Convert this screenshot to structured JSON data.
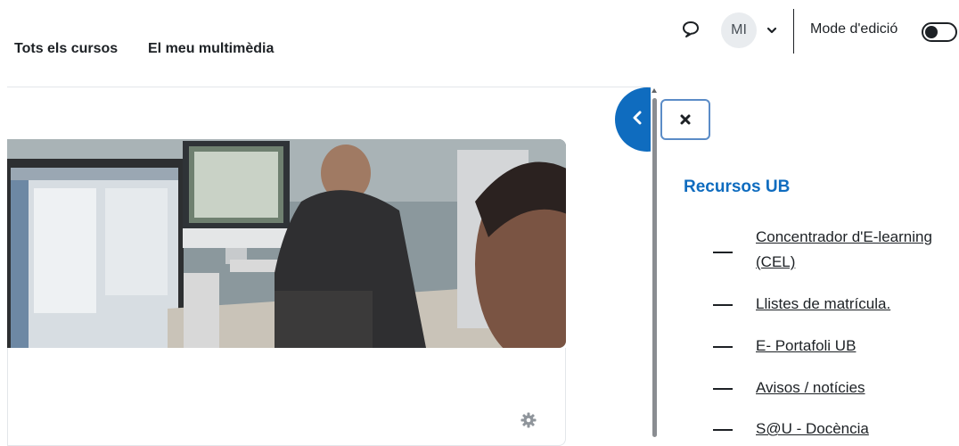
{
  "nav": {
    "links": [
      {
        "label": "Tots els cursos"
      },
      {
        "label": "El meu multimèdia"
      }
    ],
    "user_initials": "MI",
    "edit_mode_label": "Mode d'edició",
    "edit_mode_on": false,
    "icons": [
      "message-icon",
      "chevron-down-icon"
    ]
  },
  "course_card": {
    "image": "course-banner-image",
    "gear_icon": "gear-icon"
  },
  "drawer": {
    "toggle_icon": "chevron-left-icon",
    "close_icon": "close-icon",
    "block_title": "Recursos UB",
    "items": [
      {
        "label": "Concentrador d'E-learning (CEL)",
        "suffix": ""
      },
      {
        "label": "Llistes de matrícula",
        "suffix": "."
      },
      {
        "label": "E- Portafoli UB",
        "suffix": ""
      },
      {
        "label": "Avisos / notícies",
        "suffix": ""
      },
      {
        "label": "S@U - Docència",
        "suffix": ""
      }
    ]
  },
  "colors": {
    "brand": "#0f6cbf",
    "text": "#1d2125",
    "focus_border": "#5b8cc7"
  }
}
